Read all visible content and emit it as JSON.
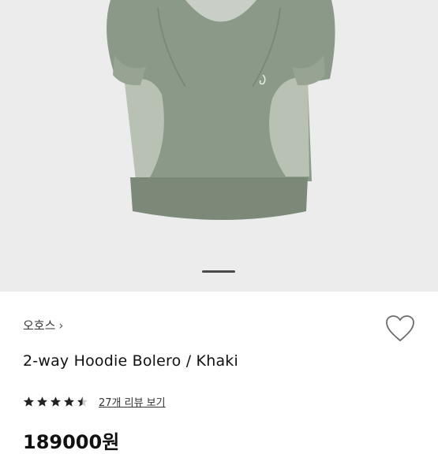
{
  "product": {
    "brand": "오호스",
    "brand_chevron_icon": "chevron-right-icon",
    "title": "2-way Hoodie Bolero / Khaki",
    "rating_stars": 4.5,
    "reviews_link": "27개 리뷰 보기",
    "price": "189000원",
    "favorite_icon": "heart-outline-icon"
  },
  "gallery": {
    "current_index": 1,
    "colors": {
      "background": "#ececec",
      "garment": "#8b9a88",
      "panel": "#b8c0b3",
      "rib": "#7d8a7a"
    }
  }
}
